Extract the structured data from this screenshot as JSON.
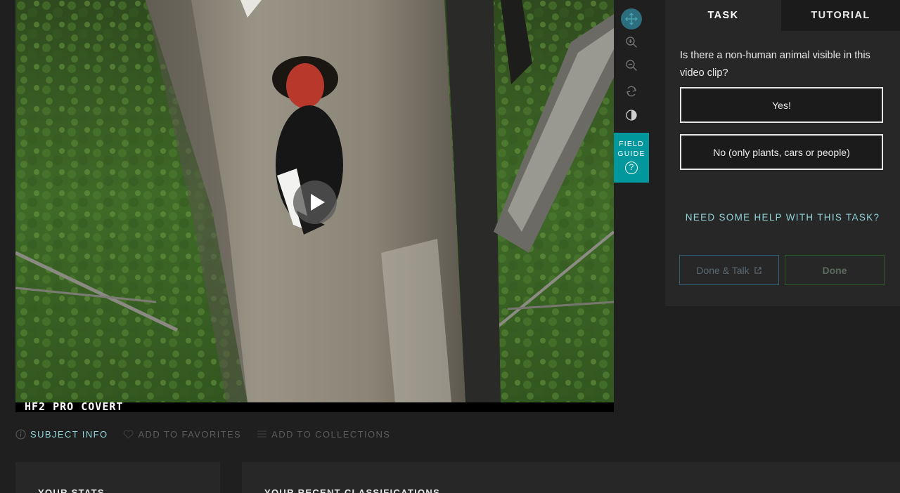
{
  "video": {
    "caption": "HF2 PRO COVERT"
  },
  "toolbar": {
    "tools": [
      "move-icon",
      "zoom-in-icon",
      "zoom-out-icon",
      "rotate-icon",
      "invert-icon"
    ],
    "field_guide_label": "FIELD\nGUIDE",
    "field_guide_help": "?"
  },
  "panel": {
    "tab_task": "TASK",
    "tab_tutorial": "TUTORIAL",
    "question": "Is there a non-human animal visible in this video clip?",
    "answers": [
      "Yes!",
      "No (only plants, cars or people)"
    ],
    "help_link": "NEED SOME HELP WITH THIS TASK?",
    "done_talk": "Done & Talk",
    "done": "Done"
  },
  "meta": {
    "subject_info": "SUBJECT INFO",
    "add_to_favorites": "ADD TO FAVORITES",
    "add_to_collections": "ADD TO COLLECTIONS"
  },
  "cards": {
    "stats_title": "YOUR STATS",
    "recent_title": "YOUR RECENT CLASSIFICATIONS"
  },
  "colors": {
    "accent_teal": "#00979d",
    "link_teal": "#8fd3d8",
    "background": "#1f1f1f",
    "panel": "#272727"
  }
}
